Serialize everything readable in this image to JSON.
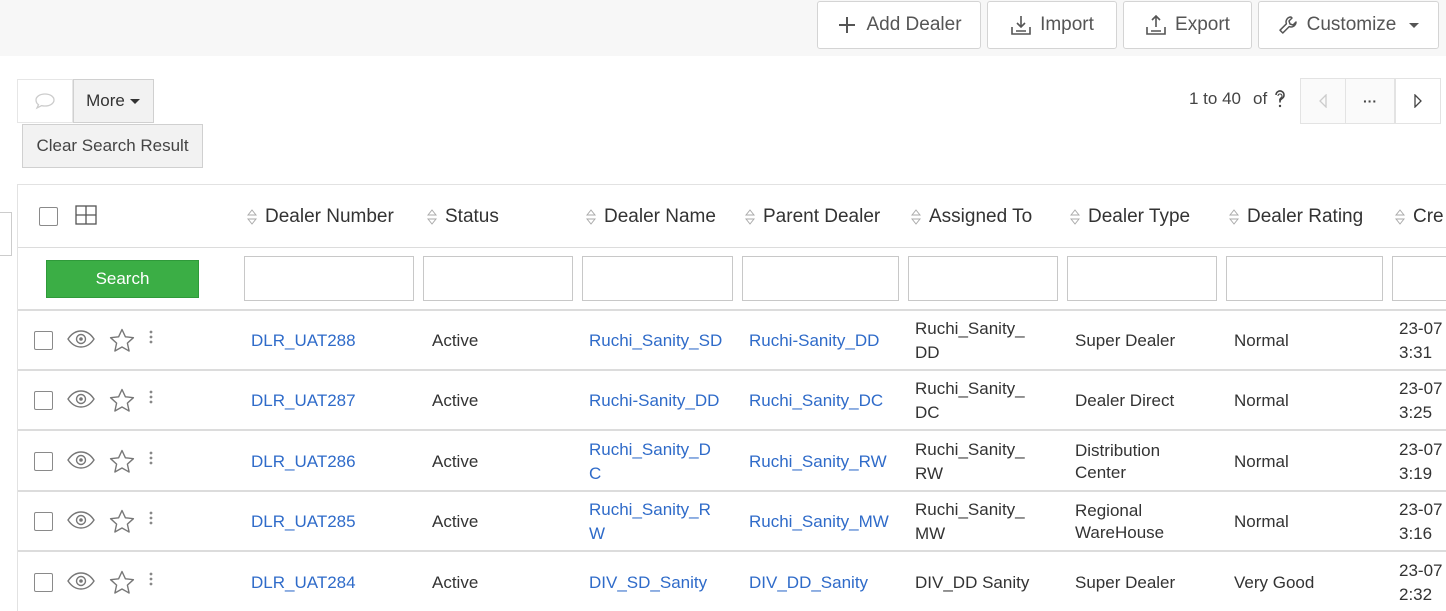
{
  "toolbar": {
    "add_dealer": "Add Dealer",
    "import": "Import",
    "export": "Export",
    "customize": "Customize"
  },
  "actions": {
    "more": "More",
    "clear_search": "Clear Search Result"
  },
  "pager": {
    "range": "1 to 40",
    "of": "of",
    "ellipsis": "···"
  },
  "table": {
    "search_button": "Search",
    "columns": [
      "Dealer Number",
      "Status",
      "Dealer Name",
      "Parent Dealer",
      "Assigned To",
      "Dealer Type",
      "Dealer Rating",
      "Cre"
    ],
    "rows": [
      {
        "dealer_number": "DLR_UAT288",
        "status": "Active",
        "dealer_name": "Ruchi_Sanity_SD",
        "parent_dealer": "Ruchi-Sanity_DD",
        "assigned_to": "Ruchi_Sanity_DD",
        "dealer_type": "Super Dealer",
        "dealer_rating": "Normal",
        "created": "23-07 3:31"
      },
      {
        "dealer_number": "DLR_UAT287",
        "status": "Active",
        "dealer_name": "Ruchi-Sanity_DD",
        "parent_dealer": "Ruchi_Sanity_DC",
        "assigned_to": "Ruchi_Sanity_DC",
        "dealer_type": "Dealer Direct",
        "dealer_rating": "Normal",
        "created": "23-07 3:25"
      },
      {
        "dealer_number": "DLR_UAT286",
        "status": "Active",
        "dealer_name": "Ruchi_Sanity_DC",
        "parent_dealer": "Ruchi_Sanity_RW",
        "assigned_to": "Ruchi_Sanity_RW",
        "dealer_type": "Distribution Center",
        "dealer_rating": "Normal",
        "created": "23-07 3:19"
      },
      {
        "dealer_number": "DLR_UAT285",
        "status": "Active",
        "dealer_name": "Ruchi_Sanity_RW",
        "parent_dealer": "Ruchi_Sanity_MW",
        "assigned_to": "Ruchi_Sanity_MW",
        "dealer_type": "Regional WareHouse",
        "dealer_rating": "Normal",
        "created": "23-07 3:16"
      },
      {
        "dealer_number": "DLR_UAT284",
        "status": "Active",
        "dealer_name": "DIV_SD_Sanity",
        "parent_dealer": "DIV_DD_Sanity",
        "assigned_to": "DIV_DD Sanity",
        "dealer_type": "Super Dealer",
        "dealer_rating": "Very Good",
        "created": "23-07 2:32"
      }
    ]
  },
  "colors": {
    "link": "#2f6bc9",
    "search_green": "#3bae45",
    "topbar_bg": "#f7f7f7"
  },
  "icons": [
    "plus-icon",
    "import-icon",
    "export-icon",
    "wrench-icon",
    "caret-down-icon",
    "chat-bubble-icon",
    "help-icon",
    "prev-icon",
    "next-icon",
    "column-grid-icon",
    "sort-icon",
    "eye-icon",
    "star-icon",
    "kebab-icon"
  ]
}
